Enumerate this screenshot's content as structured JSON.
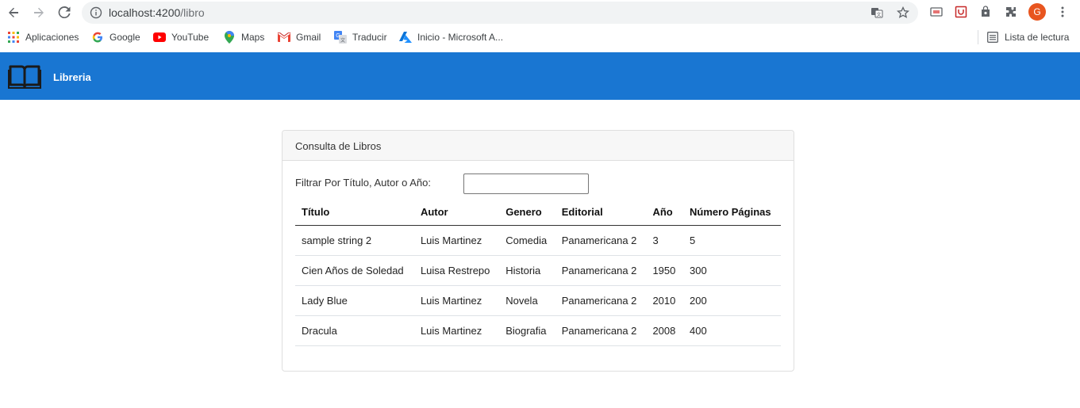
{
  "browser": {
    "url_host": "localhost:4200",
    "url_path": "/libro",
    "avatar_letter": "G"
  },
  "bookmarks": {
    "items": [
      {
        "label": "Aplicaciones",
        "icon": "apps-grid-icon"
      },
      {
        "label": "Google",
        "icon": "google-icon"
      },
      {
        "label": "YouTube",
        "icon": "youtube-icon"
      },
      {
        "label": "Maps",
        "icon": "maps-icon"
      },
      {
        "label": "Gmail",
        "icon": "gmail-icon"
      },
      {
        "label": "Traducir",
        "icon": "translate-icon"
      },
      {
        "label": "Inicio - Microsoft A...",
        "icon": "azure-icon"
      }
    ],
    "reading_list": "Lista de lectura"
  },
  "app": {
    "title": "Libreria",
    "brand_color": "#1976d2"
  },
  "card": {
    "header": "Consulta de Libros",
    "filter_label": "Filtrar Por Título, Autor o Año:",
    "filter_value": ""
  },
  "table": {
    "columns": [
      "Título",
      "Autor",
      "Genero",
      "Editorial",
      "Año",
      "Número Páginas"
    ],
    "rows": [
      [
        "sample string 2",
        "Luis Martinez",
        "Comedia",
        "Panamericana 2",
        "3",
        "5"
      ],
      [
        "Cien Años de Soledad",
        "Luisa Restrepo",
        "Historia",
        "Panamericana 2",
        "1950",
        "300"
      ],
      [
        "Lady Blue",
        "Luis Martinez",
        "Novela",
        "Panamericana 2",
        "2010",
        "200"
      ],
      [
        "Dracula",
        "Luis Martinez",
        "Biografia",
        "Panamericana 2",
        "2008",
        "400"
      ]
    ]
  }
}
